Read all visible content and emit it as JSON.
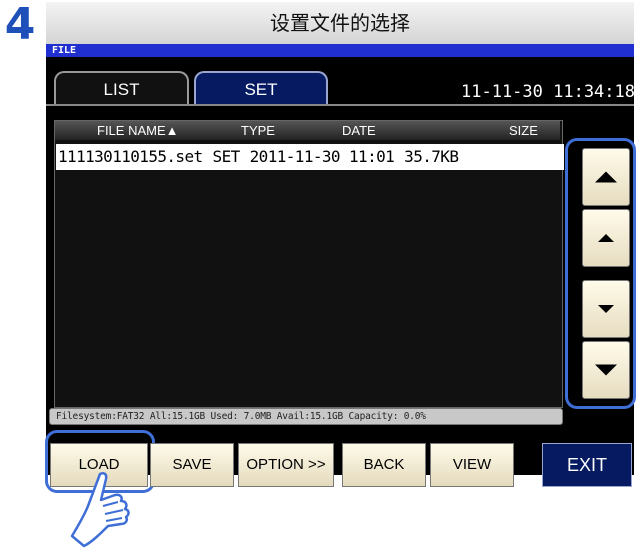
{
  "step_number": "4",
  "title": "设置文件的选择",
  "screen_label": "FILE",
  "tabs": [
    {
      "label": "LIST",
      "active": true
    },
    {
      "label": "SET",
      "active": false
    }
  ],
  "datetime": "11-11-30 11:34:18",
  "file_list": {
    "headers": [
      "FILE NAME▲",
      "TYPE",
      "DATE",
      "SIZE"
    ],
    "rows": [
      {
        "name": "111130110155.set",
        "type": "SET",
        "date": "2011-11-30 11:01",
        "size": "35.7KB"
      }
    ]
  },
  "status": "Filesystem:FAT32 All:15.1GB Used: 7.0MB Avail:15.1GB Capacity: 0.0%",
  "scroll_buttons": [
    "page-up-icon",
    "up-icon",
    "down-icon",
    "page-down-icon"
  ],
  "buttons": {
    "load": "LOAD",
    "save": "SAVE",
    "option": "OPTION >>",
    "back": "BACK",
    "view": "VIEW",
    "exit": "EXIT"
  },
  "colors": {
    "highlight": "#3f6fd6",
    "file_bar": "#1f2fd0",
    "set_tab": "#051a60",
    "step_number": "#1f4fb8"
  }
}
